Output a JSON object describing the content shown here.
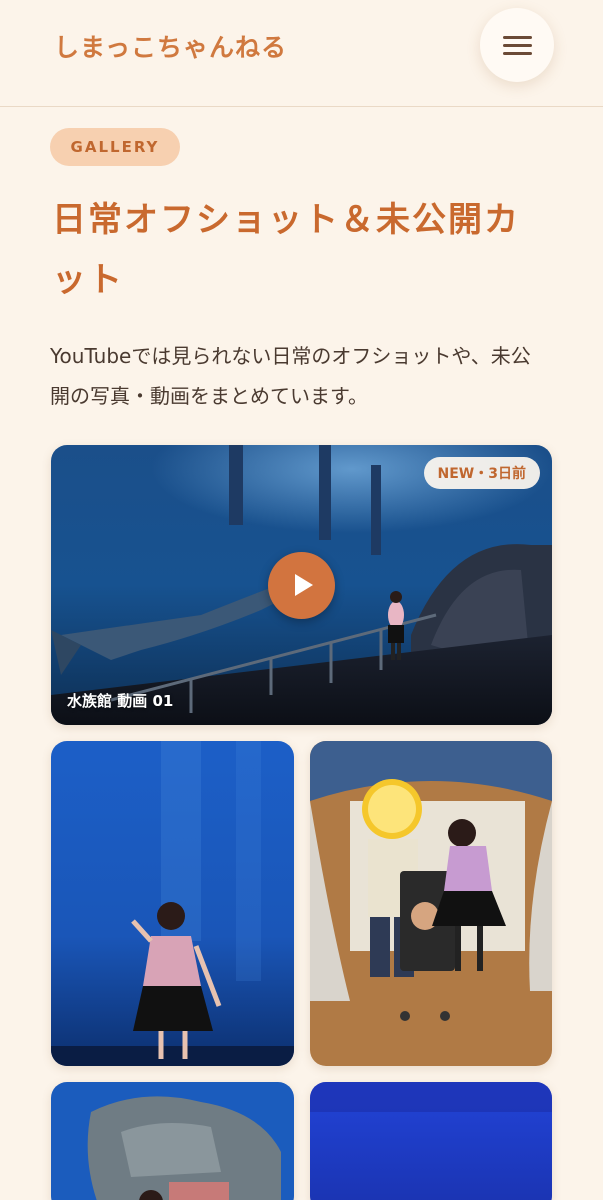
{
  "header": {
    "brand": "しまっこちゃんねる",
    "menu_icon": "hamburger-menu-icon"
  },
  "section": {
    "badge": "GALLERY",
    "title": "日常オフショット＆未公開カット",
    "description": "YouTubeでは見られない日常のオフショットや、未公開の写真・動画をまとめています。"
  },
  "gallery": {
    "featured": {
      "badge": "NEW・3日前",
      "caption": "水族館 動画 01",
      "play_icon": "play-icon"
    }
  },
  "colors": {
    "background": "#fcf4ea",
    "accent": "#d0793f",
    "badge_bg": "#f7d0b0",
    "text": "#4a3a30"
  }
}
